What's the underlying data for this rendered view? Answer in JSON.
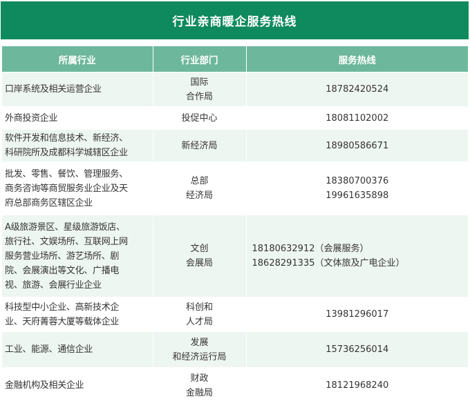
{
  "title": "行业亲商暖企服务热线",
  "headers": {
    "industry": "所属行业",
    "dept": "行业部门",
    "hotline": "服务热线"
  },
  "rows": [
    {
      "industry": [
        "口岸系统及相关运营企业"
      ],
      "dept": [
        "国际",
        "合作局"
      ],
      "phone": [
        "18782420524"
      ]
    },
    {
      "industry": [
        "外商投资企业"
      ],
      "dept": [
        "投促中心"
      ],
      "phone": [
        "18081102002"
      ]
    },
    {
      "industry": [
        "软件开发和信息技术、新经济、",
        "科研院所及成都科学城辖区企业"
      ],
      "dept": [
        "新经济局"
      ],
      "phone": [
        "18980586671"
      ]
    },
    {
      "industry": [
        "批发、零售、餐饮、管理服务、",
        "商务咨询等商贸服务业企业及天",
        "府总部商务区辖区企业"
      ],
      "dept": [
        "总部",
        "经济局"
      ],
      "phone": [
        "18380700376",
        "19961635898"
      ]
    },
    {
      "industry": [
        "A级旅游景区、星级旅游饭店、",
        "旅行社、文娱场所、互联网上网",
        "服务营业场所、游艺场所、剧",
        "院、会展演出等文化、广播电",
        "视、旅游、会展行业企业"
      ],
      "dept": [
        "文创",
        "会展局"
      ],
      "phone": [
        "18180632912（会展服务）",
        "18628291335（文体旅及广电企业）"
      ]
    },
    {
      "industry": [
        "科技型中小企业、高新技术企",
        "业、天府菁蓉大厦等载体企业"
      ],
      "dept": [
        "科创和",
        "人才局"
      ],
      "phone": [
        "13981296017"
      ]
    },
    {
      "industry": [
        "工业、能源、通信企业"
      ],
      "dept": [
        "发展",
        "和经济运行局"
      ],
      "phone": [
        "15736256014"
      ]
    },
    {
      "industry": [
        "金融机构及相关企业"
      ],
      "dept": [
        "财政",
        "金融局"
      ],
      "phone": [
        "18121968240"
      ]
    }
  ]
}
